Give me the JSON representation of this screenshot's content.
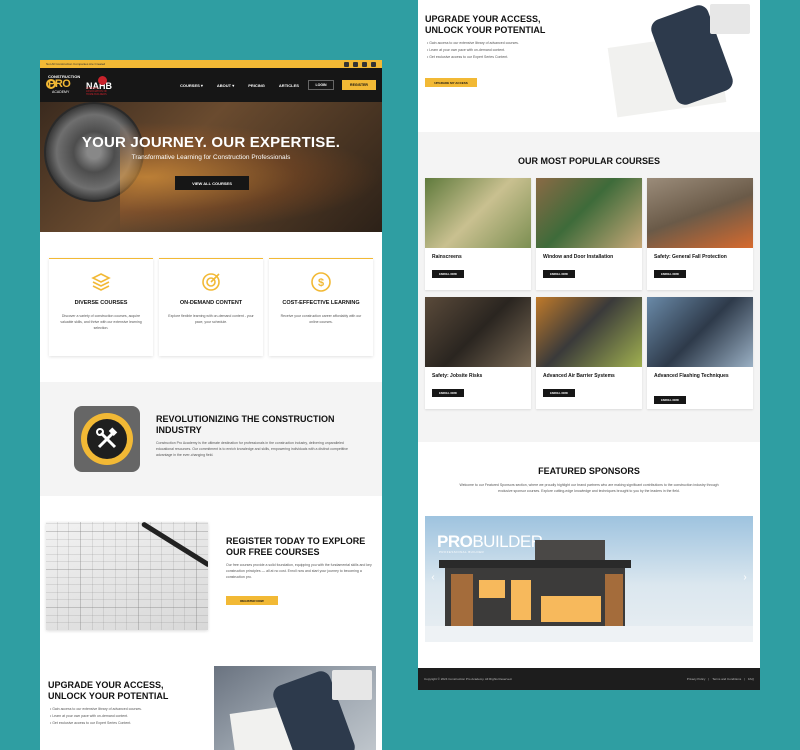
{
  "topbar": {
    "text": "Not All Construction Companies Are Created"
  },
  "header": {
    "logo_top": "CONSTRUCTION",
    "logo_main": "PRO",
    "logo_bottom": "ACADEMY",
    "partner": "NAHB",
    "partner_sub": "NATIONAL ASSOCIATION OF HOME BUILDERS",
    "nav": [
      "COURSES ▾",
      "ABOUT ▾",
      "PRICING",
      "ARTICLES"
    ],
    "login": "LOGIN",
    "register": "REGISTER"
  },
  "hero": {
    "title": "YOUR JOURNEY. OUR EXPERTISE.",
    "subtitle": "Transformative Learning for Construction Professionals",
    "button": "VIEW ALL COURSES"
  },
  "features": [
    {
      "title": "DIVERSE COURSES",
      "text": "Discover a variety of construction courses, acquire valuable skills, and thrive with our extensive learning selection.",
      "icon": "layers-icon"
    },
    {
      "title": "ON-DEMAND CONTENT",
      "text": "Explore flexible learning with on-demand content - your pace, your schedule.",
      "icon": "target-icon"
    },
    {
      "title": "COST-EFFECTIVE LEARNING",
      "text": "Receive your construction career affordably with our online courses.",
      "icon": "dollar-icon"
    }
  ],
  "revolution": {
    "title": "REVOLUTIONIZING THE CONSTRUCTION INDUSTRY",
    "text": "Construction Pro Academy is the ultimate destination for professionals in the construction industry, delivering unparalleled educational resources. Our commitment is to enrich knowledge and skills, empowering individuals with a distinct competitive advantage in the ever-changing field."
  },
  "register_free": {
    "title": "REGISTER TODAY TO EXPLORE OUR FREE COURSES",
    "text": "Our free courses provide a solid foundation, equipping you with the fundamental skills and key construction principles — all at no cost. Enroll now and start your journey to becoming a construction pro.",
    "button": "REGISTER NOW"
  },
  "upgrade": {
    "title": "UPGRADE YOUR ACCESS, UNLOCK YOUR POTENTIAL",
    "bullets": [
      "Gain access to our extensive library of advanced courses.",
      "Learn at your own pace with on-demand content.",
      "Get exclusive access to our Expert Series Content."
    ],
    "button": "UPGRADE MY ACCESS"
  },
  "popular": {
    "title": "OUR MOST POPULAR COURSES",
    "enroll_label": "ENROLL NOW",
    "courses": [
      "Rainscreens",
      "Window and Door Installation",
      "Safety: General Fall Protection",
      "Safety: Jobsite Risks",
      "Advanced Air Barrier Systems",
      "Advanced Flashing Techniques"
    ]
  },
  "sponsors": {
    "title": "FEATURED SPONSORS",
    "text": "Welcome to our Featured Sponsors section, where we proudly highlight our brand partners who are making significant contributions to the construction industry through exclusive sponsor courses. Explore cutting-edge knowledge and techniques brought to you by the leaders in the field.",
    "banner_brand_a": "PRO",
    "banner_brand_b": "BUILDER",
    "banner_sub": "PROFESSIONAL BUILDER"
  },
  "footer": {
    "copy": "Copyright © 2024 Construction Pro Academy. All Rights Reserved.",
    "links": [
      "Privacy Policy",
      "|",
      "Terms and Conditions",
      "|",
      "FAQ"
    ]
  },
  "colors": {
    "accent": "#f2b935",
    "dark": "#161616",
    "background": "#2f9ea2"
  }
}
